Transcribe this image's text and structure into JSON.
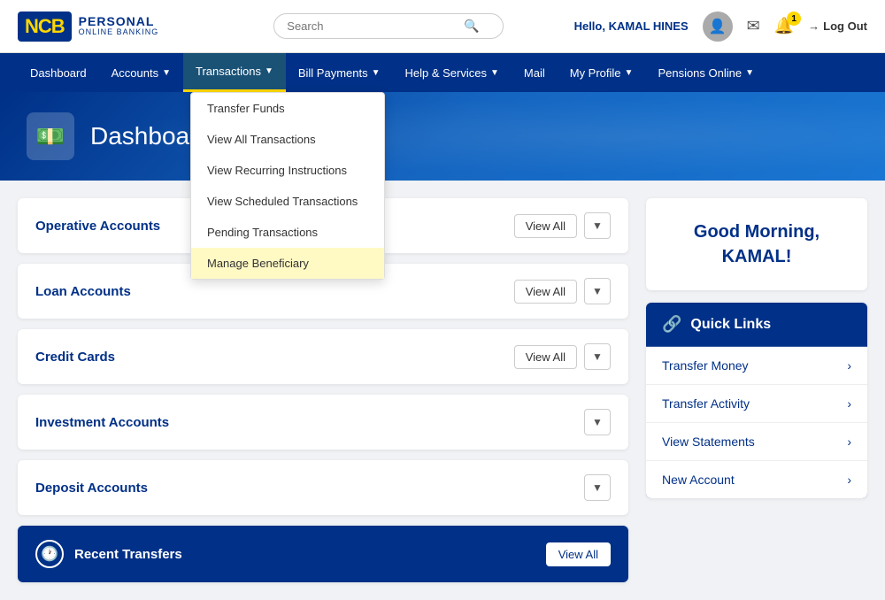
{
  "header": {
    "logo_text": "NCB",
    "brand_personal": "PERSONAL",
    "brand_online": "ONLINE BANKING",
    "search_placeholder": "Search",
    "hello_label": "Hello,",
    "username": "KAMAL HINES",
    "notification_count": "1",
    "logout_label": "Log Out"
  },
  "nav": {
    "items": [
      {
        "id": "dashboard",
        "label": "Dashboard",
        "has_dropdown": false,
        "active": true
      },
      {
        "id": "accounts",
        "label": "Accounts",
        "has_dropdown": true,
        "active": false
      },
      {
        "id": "transactions",
        "label": "Transactions",
        "has_dropdown": true,
        "active": true
      },
      {
        "id": "bill-payments",
        "label": "Bill Payments",
        "has_dropdown": true,
        "active": false
      },
      {
        "id": "help-services",
        "label": "Help & Services",
        "has_dropdown": true,
        "active": false
      },
      {
        "id": "mail",
        "label": "Mail",
        "has_dropdown": false,
        "active": false
      },
      {
        "id": "my-profile",
        "label": "My Profile",
        "has_dropdown": true,
        "active": false
      },
      {
        "id": "pensions-online",
        "label": "Pensions Online",
        "has_dropdown": true,
        "active": false
      }
    ]
  },
  "dropdown": {
    "items": [
      {
        "id": "transfer-funds",
        "label": "Transfer Funds",
        "highlighted": false
      },
      {
        "id": "view-all-transactions",
        "label": "View All Transactions",
        "highlighted": false
      },
      {
        "id": "view-recurring",
        "label": "View Recurring Instructions",
        "highlighted": false
      },
      {
        "id": "view-scheduled",
        "label": "View Scheduled Transactions",
        "highlighted": false
      },
      {
        "id": "pending-transactions",
        "label": "Pending Transactions",
        "highlighted": false
      },
      {
        "id": "manage-beneficiary",
        "label": "Manage Beneficiary",
        "highlighted": true
      }
    ]
  },
  "hero": {
    "title": "Dashboard"
  },
  "accounts": [
    {
      "id": "operative",
      "label": "Operative Accounts",
      "show_view_all": true,
      "show_chevron": true
    },
    {
      "id": "loan",
      "label": "Loan Accounts",
      "show_view_all": true,
      "show_chevron": true
    },
    {
      "id": "credit-cards",
      "label": "Credit Cards",
      "show_view_all": true,
      "show_chevron": true
    },
    {
      "id": "investment",
      "label": "Investment Accounts",
      "show_view_all": false,
      "show_chevron": true
    },
    {
      "id": "deposit",
      "label": "Deposit Accounts",
      "show_view_all": false,
      "show_chevron": true
    }
  ],
  "recent_transfers": {
    "title": "Recent Transfers",
    "view_all_label": "View All"
  },
  "greeting": {
    "text": "Good Morning, KAMAL!"
  },
  "quick_links": {
    "title": "Quick Links",
    "items": [
      {
        "id": "transfer-money",
        "label": "Transfer Money"
      },
      {
        "id": "transfer-activity",
        "label": "Transfer Activity"
      },
      {
        "id": "view-statements",
        "label": "View Statements"
      },
      {
        "id": "new-account",
        "label": "New Account"
      }
    ]
  }
}
